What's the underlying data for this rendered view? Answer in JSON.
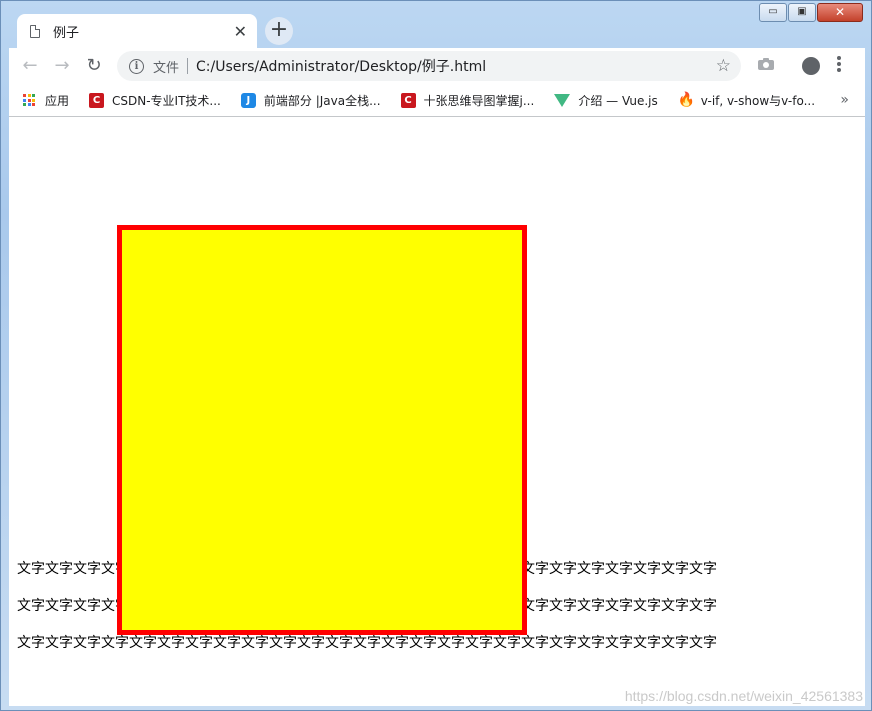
{
  "window": {
    "minimize": "▭",
    "maximize": "▣",
    "close": "✕"
  },
  "tab": {
    "title": "例子",
    "close": "✕",
    "new_tab": "+"
  },
  "toolbar": {
    "back": "←",
    "forward": "→",
    "reload": "↻",
    "info_icon": "i",
    "address_label": "文件",
    "url": "C:/Users/Administrator/Desktop/例子.html",
    "star": "☆",
    "camera": "📷",
    "menu": "⋮"
  },
  "bookmarks": {
    "items": [
      {
        "label": "应用"
      },
      {
        "label": "CSDN-专业IT技术..."
      },
      {
        "label": "前端部分 |Java全栈..."
      },
      {
        "label": "十张思维导图掌握j..."
      },
      {
        "label": "介绍 — Vue.js"
      },
      {
        "label": "v-if, v-show与v-fo..."
      }
    ],
    "more": "»"
  },
  "content": {
    "lines": [
      "文字文字文字文字文字文字文字文字文字文字文字文字文字文字文字文字文字文字文字文字文字文字文字文字文字",
      "文字文字文字文字文字文字文字文字文字文字文字文字文字文字文字文字文字文字文字文字文字文字文字文字文字",
      "文字文字文字文字文字文字文字文字文字文字文字文字文字文字文字文字文字文字文字文字文字文字文字文字文字"
    ],
    "box_color": "#ffff00",
    "box_border_color": "#ff0000"
  },
  "watermark": "https://blog.csdn.net/weixin_42561383"
}
